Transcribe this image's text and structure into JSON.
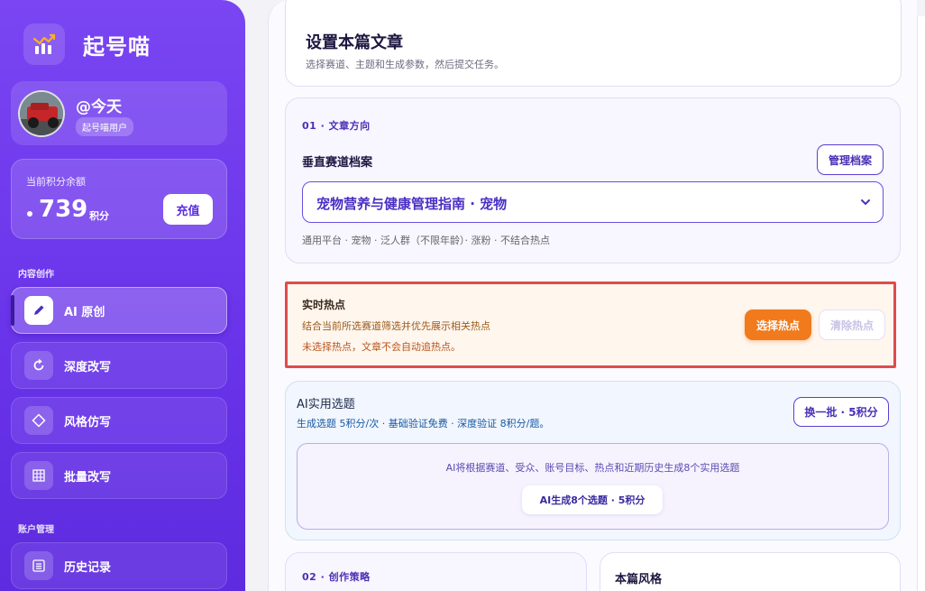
{
  "brand": {
    "name": "起号喵"
  },
  "user": {
    "name": "@今天",
    "tag": "起号喵用户"
  },
  "points": {
    "label": "当前积分余额",
    "value": "739",
    "unit": "积分",
    "recharge_label": "充值"
  },
  "nav": {
    "section_content": "内容创作",
    "section_account": "账户管理",
    "items": [
      {
        "label": "AI 原创",
        "icon": "pen-icon",
        "active": true
      },
      {
        "label": "深度改写",
        "icon": "refresh-icon",
        "active": false
      },
      {
        "label": "风格仿写",
        "icon": "diamond-icon",
        "active": false
      },
      {
        "label": "批量改写",
        "icon": "grid-icon",
        "active": false
      },
      {
        "label": "历史记录",
        "icon": "list-icon",
        "active": false
      }
    ]
  },
  "header": {
    "title": "设置本篇文章",
    "subtitle": "选择赛道、主题和生成参数，然后提交任务。"
  },
  "direction": {
    "step": "01 · 文章方向",
    "field_label": "垂直赛道档案",
    "manage_label": "管理档案",
    "selected": "宠物营养与健康管理指南 · 宠物",
    "hint": "通用平台 · 宠物 · 泛人群（不限年龄）· 涨粉 · 不结合热点"
  },
  "hot": {
    "title": "实时热点",
    "desc": "结合当前所选赛道筛选并优先展示相关热点",
    "warn": "未选择热点，文章不会自动追热点。",
    "select_label": "选择热点",
    "clear_label": "清除热点"
  },
  "ai_topics": {
    "title": "AI实用选题",
    "subtitle": "生成选题 5积分/次 · 基础验证免费 · 深度验证 8积分/题。",
    "refresh_label": "换一批 · 5积分",
    "inner_text": "AI将根据赛道、受众、账号目标、热点和近期历史生成8个实用选题",
    "generate_label": "AI生成8个选题 · 5积分"
  },
  "strategy": {
    "step": "02 · 创作策略"
  },
  "style": {
    "title": "本篇风格"
  },
  "colors": {
    "accent": "#6a34ea",
    "orange": "#f07a1c",
    "alert": "#e04b4b"
  }
}
